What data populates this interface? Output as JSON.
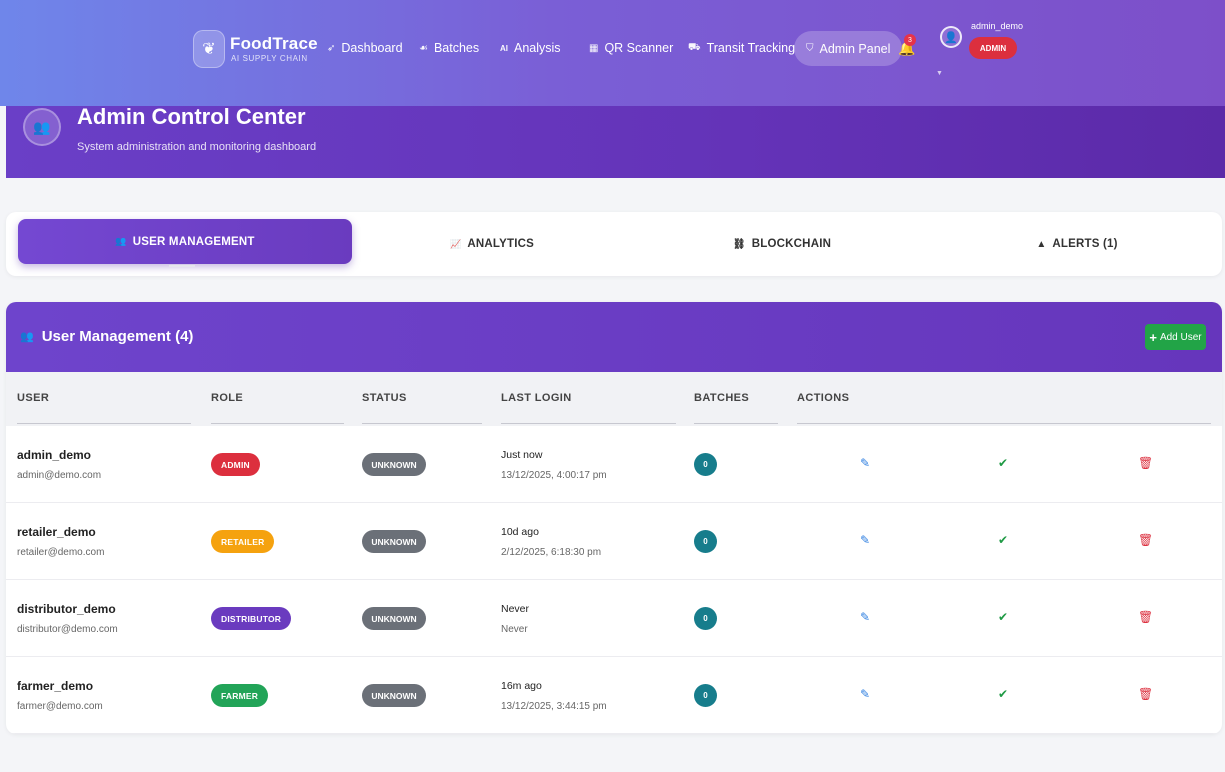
{
  "nav": {
    "brand": "FoodTrace",
    "tagline": "AI SUPPLY CHAIN",
    "items": [
      {
        "label": "Dashboard",
        "icon": "rocket-icon",
        "glyph": "➶"
      },
      {
        "label": "Batches",
        "icon": "leaf-icon",
        "glyph": "☙"
      },
      {
        "label": "Analysis",
        "icon": "ai-icon",
        "glyph": "AI"
      },
      {
        "label": "QR Scanner",
        "icon": "qr-icon",
        "glyph": "▦"
      },
      {
        "label": "Transit Tracking",
        "icon": "truck-icon",
        "glyph": "⛟"
      },
      {
        "label": "Admin Panel",
        "icon": "shield-icon",
        "glyph": "⛉"
      }
    ],
    "notification_count": "3",
    "user": {
      "name": "admin_demo",
      "role": "ADMIN"
    }
  },
  "hero": {
    "title": "Admin Control Center",
    "subtitle": "System administration and monitoring dashboard"
  },
  "tabs": [
    {
      "label": "USER MANAGEMENT",
      "icon": "users-icon",
      "glyph": "👥"
    },
    {
      "label": "ANALYTICS",
      "icon": "chart-line-icon",
      "glyph": "📈"
    },
    {
      "label": "BLOCKCHAIN",
      "icon": "network-icon",
      "glyph": "⛓"
    },
    {
      "label": "ALERTS (1)",
      "icon": "warning-icon",
      "glyph": "▲"
    }
  ],
  "users_card": {
    "title": "User Management (4)",
    "add_label": "Add User",
    "columns": [
      "USER",
      "ROLE",
      "STATUS",
      "LAST LOGIN",
      "BATCHES",
      "ACTIONS"
    ],
    "rows": [
      {
        "name": "admin_demo",
        "email": "admin@demo.com",
        "role": "ADMIN",
        "role_color": "#dc2f3e",
        "status": "UNKNOWN",
        "last_login": "Just now",
        "last_login_full": "13/12/2025, 4:00:17 pm",
        "batches": "0"
      },
      {
        "name": "retailer_demo",
        "email": "retailer@demo.com",
        "role": "RETAILER",
        "role_color": "#f5a20f",
        "status": "UNKNOWN",
        "last_login": "10d ago",
        "last_login_full": "2/12/2025, 6:18:30 pm",
        "batches": "0"
      },
      {
        "name": "distributor_demo",
        "email": "distributor@demo.com",
        "role": "DISTRIBUTOR",
        "role_color": "#6a3bbf",
        "status": "UNKNOWN",
        "last_login": "Never",
        "last_login_full": "Never",
        "batches": "0"
      },
      {
        "name": "farmer_demo",
        "email": "farmer@demo.com",
        "role": "FARMER",
        "role_color": "#22a458",
        "status": "UNKNOWN",
        "last_login": "16m ago",
        "last_login_full": "13/12/2025, 3:44:15 pm",
        "batches": "0"
      }
    ]
  },
  "colors": {
    "primary": "#6a3bbf",
    "nav_gradient_start": "#6f86ea",
    "success": "#22a447",
    "danger": "#dc2f3e",
    "teal": "#177d8c"
  }
}
